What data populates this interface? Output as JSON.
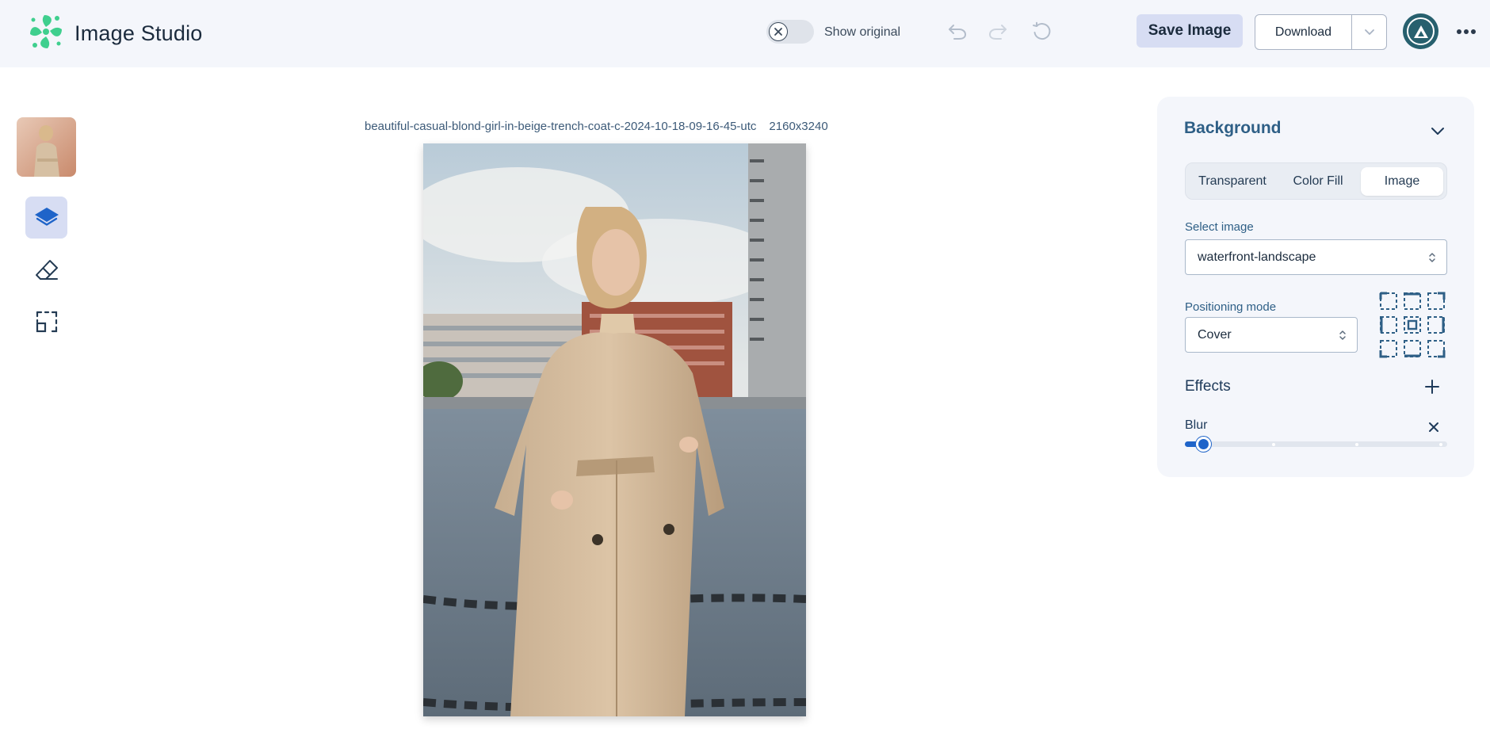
{
  "app": {
    "title": "Image Studio"
  },
  "header": {
    "show_original_label": "Show original",
    "show_original_on": false,
    "save_label": "Save Image",
    "download_label": "Download"
  },
  "file": {
    "name": "beautiful-casual-blond-girl-in-beige-trench-coat-c-2024-10-18-09-16-45-utc",
    "dimensions": "2160x3240"
  },
  "tools": [
    {
      "name": "layers",
      "icon": "layers-icon",
      "active": true
    },
    {
      "name": "eraser",
      "icon": "eraser-icon",
      "active": false
    },
    {
      "name": "crop",
      "icon": "crop-icon",
      "active": false
    }
  ],
  "panel": {
    "title": "Background",
    "segments": [
      "Transparent",
      "Color Fill",
      "Image"
    ],
    "active_segment": "Image",
    "select_image_label": "Select image",
    "select_image_value": "waterfront-landscape",
    "positioning_label": "Positioning mode",
    "positioning_value": "Cover",
    "effects_label": "Effects",
    "blur_label": "Blur",
    "blur_value": 0.07
  },
  "colors": {
    "accent": "#1f64c9",
    "header_bg": "#f4f6fb",
    "active_bg": "#d7ddf3",
    "brand_green": "#3fcf8e"
  }
}
